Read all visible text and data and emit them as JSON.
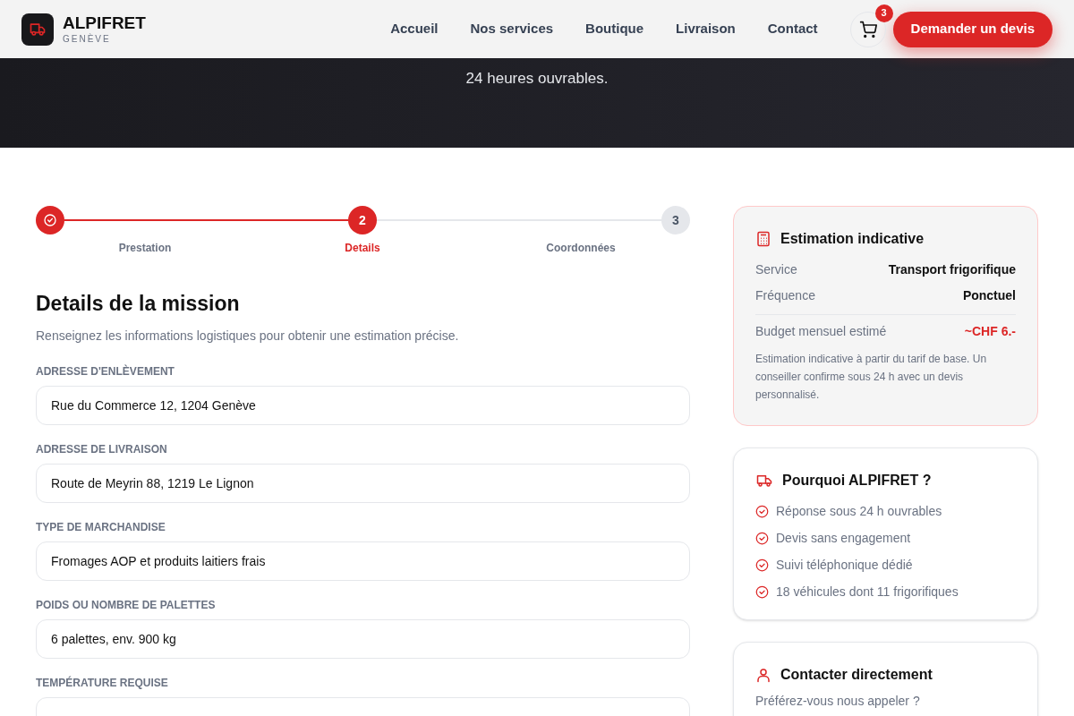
{
  "header": {
    "brand": "ALPIFRET",
    "brand_sub": "GENÈVE",
    "nav": [
      {
        "label": "Accueil"
      },
      {
        "label": "Nos services"
      },
      {
        "label": "Boutique"
      },
      {
        "label": "Livraison"
      },
      {
        "label": "Contact"
      }
    ],
    "cart_count": "3",
    "cta": "Demander un devis"
  },
  "hero": {
    "subtitle_tail": "24 heures ouvrables."
  },
  "steps": [
    {
      "label": "Prestation",
      "completed": true,
      "selected": false
    },
    {
      "marker": "2",
      "label": "Details",
      "completed": false,
      "selected": true
    },
    {
      "marker": "3",
      "label": "Coordonnées",
      "completed": false,
      "selected": false
    }
  ],
  "form": {
    "title": "Details de la mission",
    "subtitle": "Renseignez les informations logistiques pour obtenir une estimation précise.",
    "fields": [
      {
        "label": "ADRESSE D'ENLÈVEMENT",
        "value": "Rue du Commerce 12, 1204 Genève"
      },
      {
        "label": "ADRESSE DE LIVRAISON",
        "value": "Route de Meyrin 88, 1219 Le Lignon"
      },
      {
        "label": "TYPE DE MARCHANDISE",
        "value": "Fromages AOP et produits laitiers frais"
      },
      {
        "label": "POIDS OU NOMBRE DE PALETTES",
        "value": "6 palettes, env. 900 kg"
      },
      {
        "label": "TEMPÉRATURE REQUISE"
      }
    ]
  },
  "estimate": {
    "title": "Estimation indicative",
    "rows": [
      {
        "label": "Service",
        "value": "Transport frigorifique"
      },
      {
        "label": "Fréquence",
        "value": "Ponctuel"
      }
    ],
    "budget_label": "Budget mensuel estimé",
    "budget_value": "~CHF 6.-",
    "note": "Estimation indicative à partir du tarif de base. Un conseiller confirme sous 24 h avec un devis personnalisé."
  },
  "why": {
    "title": "Pourquoi ALPIFRET ?",
    "items": [
      "Réponse sous 24 h ouvrables",
      "Devis sans engagement",
      "Suivi téléphonique dédié",
      "18 véhicules dont 11 frigorifiques"
    ]
  },
  "contact": {
    "title": "Contacter directement",
    "text": "Préférez-vous nous appeler ?"
  }
}
